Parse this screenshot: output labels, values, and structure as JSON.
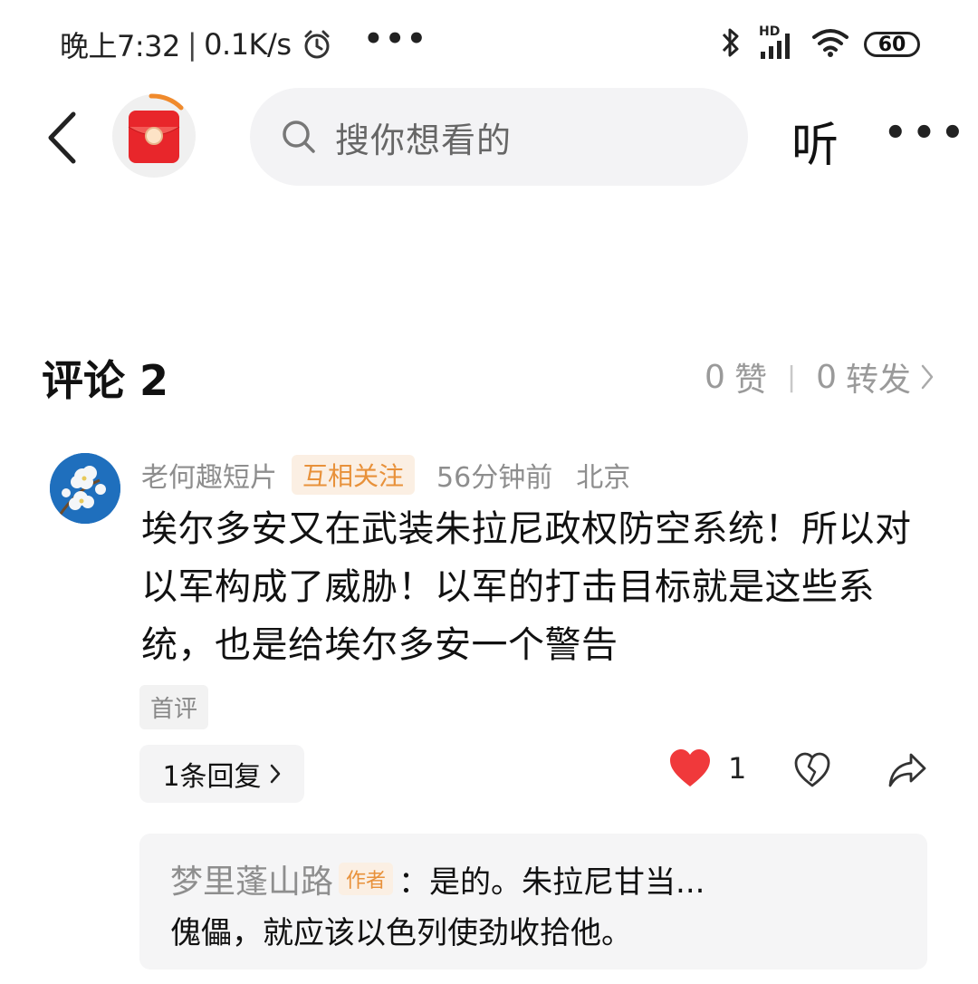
{
  "status_bar": {
    "time": "晚上7:32",
    "sep": "|",
    "speed": "0.1K/s",
    "dots": "•••",
    "hd": "HD",
    "battery": "60"
  },
  "top_bar": {
    "search_placeholder": "搜你想看的",
    "listen_label": "听",
    "more_label": "•••"
  },
  "comments": {
    "title": "评论 2",
    "likes_count": "0",
    "likes_label": "赞",
    "divider": "|",
    "reposts_count": "0",
    "reposts_label": "转发"
  },
  "comment": {
    "author": "老何趣短片",
    "badge": "互相关注",
    "time": "56分钟前",
    "location": "北京",
    "text": "埃尔多安又在武装朱拉尼政权防空系统！所以对以军构成了威胁！以军的打击目标就是这些系统，也是给埃尔多安一个警告",
    "tag": "首评",
    "reply_count_label": "1条回复",
    "like_count": "1"
  },
  "reply": {
    "author": "梦里蓬山路",
    "author_tag": "作者",
    "line1": "：是的。朱拉尼甘当...",
    "line2": "傀儡，就应该以色列使劲收拾他。"
  },
  "colors": {
    "accent_orange": "#e8913a",
    "heart_red": "#f0393b",
    "redpack_red": "#e8262b",
    "muted_text": "#8e8e8e"
  },
  "icons": [
    "back-arrow-icon",
    "red-packet-icon",
    "search-icon",
    "alarm-icon",
    "bluetooth-icon",
    "signal-icon",
    "wifi-icon",
    "heart-filled-icon",
    "broken-heart-icon",
    "share-icon",
    "chevron-right-icon"
  ]
}
